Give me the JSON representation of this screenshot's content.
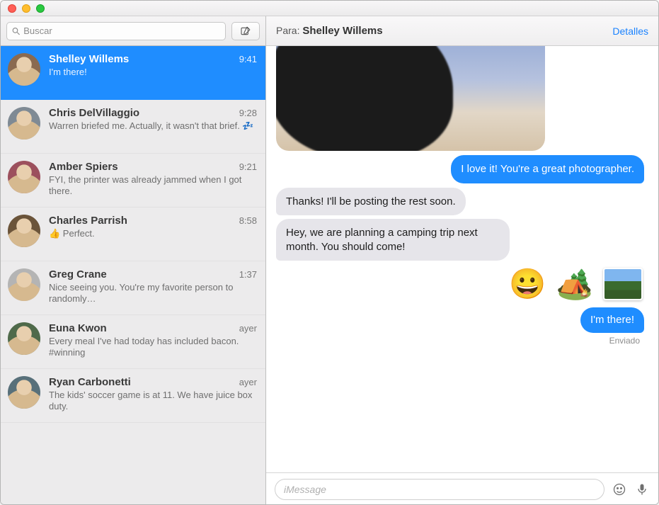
{
  "window_controls": {
    "close": "close",
    "minimize": "minimize",
    "zoom": "zoom"
  },
  "search": {
    "placeholder": "Buscar"
  },
  "header": {
    "to_label": "Para:",
    "to_name": "Shelley Willems",
    "details_label": "Detalles"
  },
  "compose": {
    "placeholder": "iMessage"
  },
  "status_delivered": "Enviado",
  "conversations": [
    {
      "name": "Shelley Willems",
      "time": "9:41",
      "preview": "I'm there!",
      "selected": true
    },
    {
      "name": "Chris DelVillaggio",
      "time": "9:28",
      "preview": "Warren briefed me. Actually, it wasn't that brief. 💤"
    },
    {
      "name": "Amber Spiers",
      "time": "9:21",
      "preview": "FYI, the printer was already jammed when I got there."
    },
    {
      "name": "Charles Parrish",
      "time": "8:58",
      "preview": "👍 Perfect."
    },
    {
      "name": "Greg Crane",
      "time": "1:37",
      "preview": "Nice seeing you. You're my favorite person to randomly…"
    },
    {
      "name": "Euna Kwon",
      "time": "ayer",
      "preview": "Every meal I've had today has included bacon. #winning"
    },
    {
      "name": "Ryan Carbonetti",
      "time": "ayer",
      "preview": "The kids' soccer game is at 11. We have juice box duty."
    }
  ],
  "thread": {
    "m1_out": "I love it! You're a great photographer.",
    "m2_in": "Thanks! I'll be posting the rest soon.",
    "m3_in": "Hey, we are planning a camping trip next month. You should come!",
    "m4_emojis": {
      "grin": "😀",
      "tent": "🏕️"
    },
    "m5_out": "I'm there!"
  },
  "icons": {
    "search": "search-icon",
    "compose": "compose-icon",
    "emoji_picker": "emoji-picker-icon",
    "mic": "microphone-icon"
  },
  "colors": {
    "accent_blue": "#1f8dff",
    "link_blue": "#1a82ff"
  }
}
